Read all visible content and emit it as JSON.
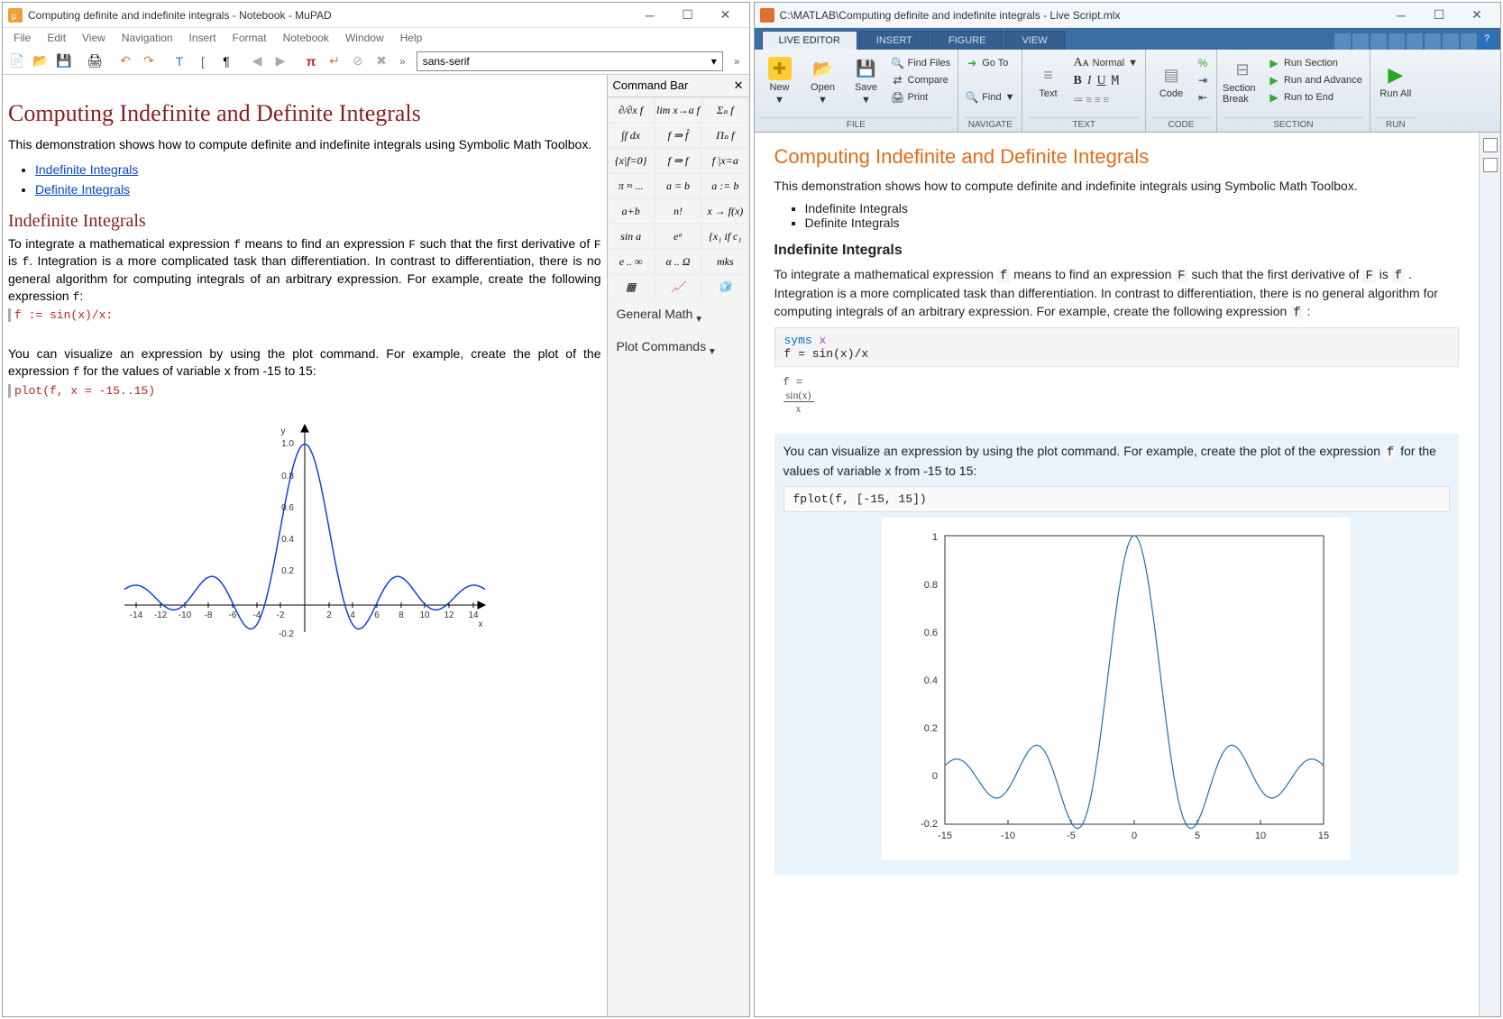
{
  "mupad": {
    "title": "Computing definite and indefinite integrals - Notebook - MuPAD",
    "menu": [
      "File",
      "Edit",
      "View",
      "Navigation",
      "Insert",
      "Format",
      "Notebook",
      "Window",
      "Help"
    ],
    "font": "sans-serif",
    "h1": "Computing Indefinite and Definite Integrals",
    "intro": "This demonstration shows how to compute definite and indefinite integrals using Symbolic Math Toolbox.",
    "link1": "Indefinite Integrals",
    "link2": "Definite Integrals",
    "h2": "Indefinite Integrals",
    "p1a": "To integrate a mathematical expression ",
    "p1b": " means to find an expression ",
    "p1c": " such that the first derivative of ",
    "p1d": " is ",
    "p1e": ". Integration is a more complicated task than differentiation. In contrast to differentiation, there is no general algorithm for computing integrals of an arbitrary expression. For example, create the following expression ",
    "code1": "f := sin(x)/x:",
    "p2a": "You can visualize an expression by using the plot command. For example, create the plot of the expression ",
    "p2b": " for the values of variable x from -15 to 15:",
    "code2": "plot(f, x = -15..15)",
    "cmdbar_title": "Command Bar",
    "cmd_general": "General Math",
    "cmd_plot": "Plot Commands",
    "cmdcells": [
      "∂/∂x f",
      "lim x→a f",
      "Σₙ f",
      "∫f dx",
      "f ⇒ f̂",
      "Πₙ f",
      "{x|f=0}",
      "f ⇒ f",
      "f |x=a",
      "π ≈ ...",
      "a = b",
      "a := b",
      "a+b",
      "n!",
      "x → f(x)",
      "sin a",
      "eᵃ",
      "{x₁ if c₁",
      "e .. ∞",
      "α .. Ω",
      "mks"
    ]
  },
  "matlab": {
    "title": "C:\\MATLAB\\Computing definite and indefinite integrals - Live Script.mlx",
    "tabs": [
      "LIVE EDITOR",
      "INSERT",
      "FIGURE",
      "VIEW"
    ],
    "ribbon": {
      "file": {
        "label": "FILE",
        "new": "New",
        "open": "Open",
        "save": "Save",
        "findfiles": "Find Files",
        "compare": "Compare",
        "print": "Print"
      },
      "navigate": {
        "label": "NAVIGATE",
        "goto": "Go To",
        "find": "Find"
      },
      "text": {
        "label": "TEXT",
        "text": "Text",
        "normal": "Normal"
      },
      "code": {
        "label": "CODE",
        "code": "Code"
      },
      "section": {
        "label": "SECTION",
        "break": "Section Break",
        "runsec": "Run Section",
        "runadv": "Run and Advance",
        "runend": "Run to End"
      },
      "run": {
        "label": "RUN",
        "runall": "Run All"
      }
    },
    "h1": "Computing Indefinite and Definite Integrals",
    "intro": "This demonstration shows how to compute definite and indefinite integrals using Symbolic Math Toolbox.",
    "li1": "Indefinite Integrals",
    "li2": "Definite Integrals",
    "h2": "Indefinite Integrals",
    "p1a": "To integrate a mathematical expression ",
    "p1b": " means to find an expression ",
    "p1c": " such that the first derivative of ",
    "p1d": " is ",
    "p1e": " . Integration is a more complicated task than differentiation. In contrast to differentiation, there is no general algorithm for computing integrals of an arbitrary expression. For example, create the following expression ",
    "code1a": "syms",
    "code1b": " x",
    "code1c": "f = sin(x)/x",
    "out_f": "f =",
    "out_num": "sin(x)",
    "out_den": "x",
    "p2a": "You can visualize an expression by using the plot command. For example, create the plot of the expression ",
    "p2b": " for the values of variable x from -15 to 15:",
    "code2": "fplot(f, [-15, 15])"
  },
  "chart_data": [
    {
      "type": "line",
      "title": "",
      "xlabel": "x",
      "ylabel": "y",
      "xlim": [
        -15,
        15
      ],
      "ylim": [
        -0.25,
        1.0
      ],
      "xticks": [
        -14,
        -12,
        -10,
        -8,
        -6,
        -4,
        -2,
        2,
        4,
        6,
        8,
        10,
        12,
        14
      ],
      "yticks": [
        -0.2,
        0.2,
        0.4,
        0.6,
        0.8,
        1.0
      ],
      "series": [
        {
          "name": "sin(x)/x",
          "function": "sinc",
          "domain": [
            -15,
            15
          ]
        }
      ]
    },
    {
      "type": "line",
      "title": "",
      "xlabel": "",
      "ylabel": "",
      "xlim": [
        -15,
        15
      ],
      "ylim": [
        -0.2,
        1.0
      ],
      "xticks": [
        -15,
        -10,
        -5,
        0,
        5,
        10,
        15
      ],
      "yticks": [
        -0.2,
        0,
        0.2,
        0.4,
        0.6,
        0.8,
        1.0
      ],
      "series": [
        {
          "name": "sin(x)/x",
          "function": "sinc",
          "domain": [
            -15,
            15
          ]
        }
      ]
    }
  ]
}
